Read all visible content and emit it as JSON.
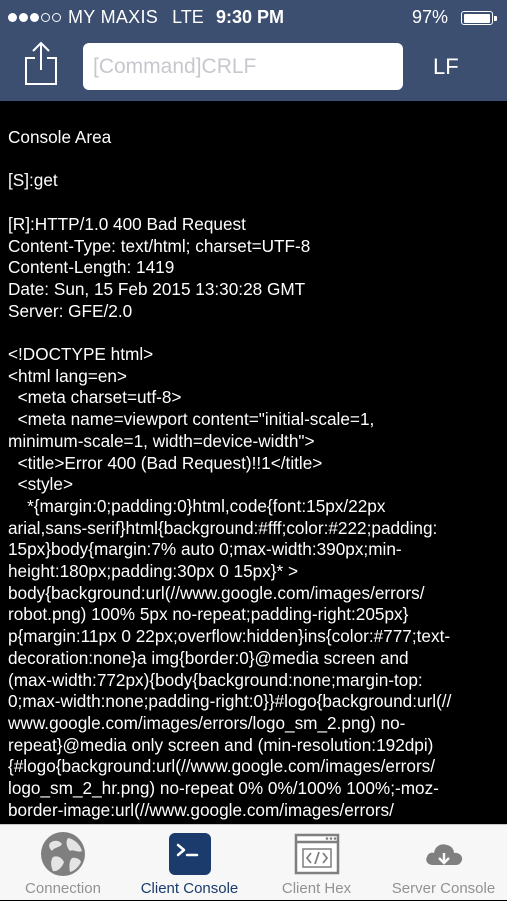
{
  "status_bar": {
    "carrier": "MY MAXIS",
    "network": "LTE",
    "time": "9:30 PM",
    "battery": "97%"
  },
  "toolbar": {
    "command_placeholder": "[Command]CRLF",
    "line_ending": "LF",
    "share_icon": "share-icon"
  },
  "console": {
    "text": "Console Area\n\n[S]:get\n\n[R]:HTTP/1.0 400 Bad Request\nContent-Type: text/html; charset=UTF-8\nContent-Length: 1419\nDate: Sun, 15 Feb 2015 13:30:28 GMT\nServer: GFE/2.0\n\n<!DOCTYPE html>\n<html lang=en>\n  <meta charset=utf-8>\n  <meta name=viewport content=\"initial-scale=1,\nminimum-scale=1, width=device-width\">\n  <title>Error 400 (Bad Request)!!1</title>\n  <style>\n    *{margin:0;padding:0}html,code{font:15px/22px\narial,sans-serif}html{background:#fff;color:#222;padding:\n15px}body{margin:7% auto 0;max-width:390px;min-\nheight:180px;padding:30px 0 15px}* >\nbody{background:url(//www.google.com/images/errors/\nrobot.png) 100% 5px no-repeat;padding-right:205px}\np{margin:11px 0 22px;overflow:hidden}ins{color:#777;text-\ndecoration:none}a img{border:0}@media screen and\n(max-width:772px){body{background:none;margin-top:\n0;max-width:none;padding-right:0}}#logo{background:url(//\nwww.google.com/images/errors/logo_sm_2.png) no-\nrepeat}@media only screen and (min-resolution:192dpi)\n{#logo{background:url(//www.google.com/images/errors/\nlogo_sm_2_hr.png) no-repeat 0% 0%/100% 100%;-moz-\nborder-image:url(//www.google.com/images/errors/"
  },
  "tabs": [
    {
      "label": "Connection",
      "icon": "globe-icon",
      "active": false
    },
    {
      "label": "Client Console",
      "icon": "terminal-icon",
      "active": true
    },
    {
      "label": "Client Hex",
      "icon": "code-window-icon",
      "active": false
    },
    {
      "label": "Server Console",
      "icon": "cloud-icon",
      "active": false
    }
  ],
  "colors": {
    "header_bg": "#3c4f70",
    "console_bg": "#000000",
    "console_text": "#ffffff",
    "tab_active": "#1a3b6b",
    "tab_inactive": "#929292"
  }
}
